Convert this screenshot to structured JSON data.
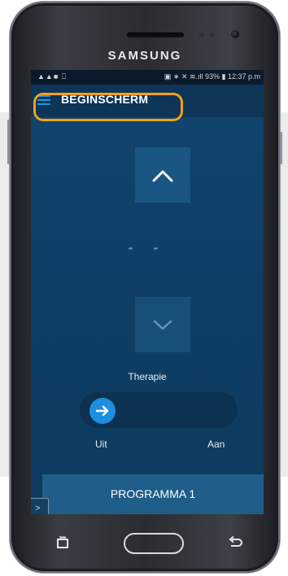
{
  "device": {
    "brand": "SAMSUNG"
  },
  "status_bar": {
    "left_icons": "▲▲■ ⎕",
    "right_text": "▣ ∗ ✕ ≋.ıll 93% ▮ 12:37 p.m"
  },
  "app_bar": {
    "title": "BEGINSCHERM"
  },
  "controls": {
    "value_display": "- -",
    "therapy_label": "Therapie",
    "toggle_off_label": "Uit",
    "toggle_on_label": "Aan",
    "therapy_on": false
  },
  "program": {
    "label": "PROGRAMMA 1"
  },
  "icons": {
    "menu": "hamburger-icon",
    "up": "chevron-up-icon",
    "down": "chevron-down-icon",
    "toggle": "arrow-right-icon",
    "expand": "chevron-right-icon"
  },
  "colors": {
    "screen_bg": "#0f3f66",
    "accent": "#1d8fe0",
    "highlight": "#f2a114"
  }
}
